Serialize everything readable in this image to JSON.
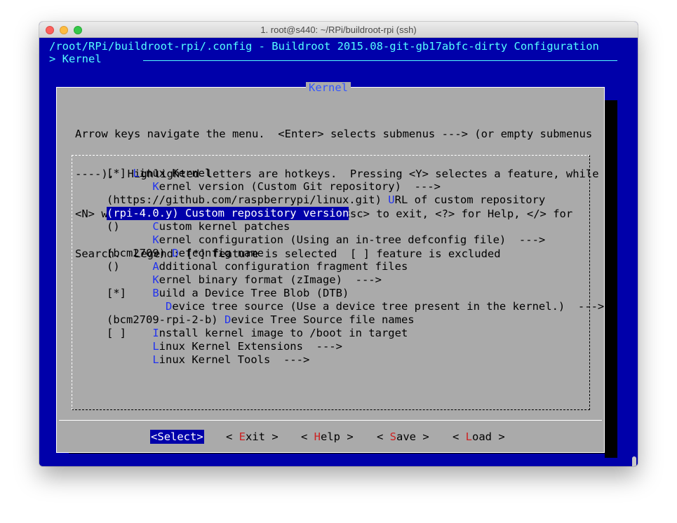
{
  "window": {
    "title": "1. root@s440: ~/RPi/buildroot-rpi (ssh)"
  },
  "header": {
    "path": "/root/RPi/buildroot-rpi/.config - Buildroot 2015.08-git-gb17abfc-dirty Configuration",
    "breadcrumb": "> Kernel"
  },
  "dialog": {
    "title": "Kernel",
    "help_lines": [
      "Arrow keys navigate the menu.  <Enter> selects submenus ---> (or empty submenus",
      "----).  Highlighted letters are hotkeys.  Pressing <Y> selectes a feature, while",
      "<N> will exclude a feature.  Press <Esc><Esc> to exit, <?> for Help, </> for",
      "Search.  Legend: [*] feature is selected  [ ] feature is excluded"
    ]
  },
  "menu": [
    {
      "prefix": "[*] ",
      "hotkey": "L",
      "rest": "inux Kernel"
    },
    {
      "prefix": "       ",
      "hotkey": "K",
      "rest": "ernel version (Custom Git repository)  --->"
    },
    {
      "prefix": "(https://github.com/raspberrypi/linux.git) ",
      "hotkey": "U",
      "rest": "RL of custom repository"
    },
    {
      "prefix": "(rpi-4.0.y) ",
      "hotkey": "C",
      "rest": "ustom repository version",
      "selected": true
    },
    {
      "prefix": "()     ",
      "hotkey": "C",
      "rest": "ustom kernel patches"
    },
    {
      "prefix": "       ",
      "hotkey": "K",
      "rest": "ernel configuration (Using an in-tree defconfig file)  --->"
    },
    {
      "prefix": "(bcm2709) ",
      "hotkey": "D",
      "rest": "efconfig name"
    },
    {
      "prefix": "()     ",
      "hotkey": "A",
      "rest": "dditional configuration fragment files"
    },
    {
      "prefix": "       ",
      "hotkey": "K",
      "rest": "ernel binary format (zImage)  --->"
    },
    {
      "prefix": "[*]    ",
      "hotkey": "B",
      "rest": "uild a Device Tree Blob (DTB)"
    },
    {
      "prefix": "         ",
      "hotkey": "D",
      "rest": "evice tree source (Use a device tree present in the kernel.)  --->"
    },
    {
      "prefix": "(bcm2709-rpi-2-b) ",
      "hotkey": "D",
      "rest": "evice Tree Source file names"
    },
    {
      "prefix": "[ ]    ",
      "hotkey": "I",
      "rest": "nstall kernel image to /boot in target"
    },
    {
      "prefix": "       ",
      "hotkey": "L",
      "rest": "inux Kernel Extensions  --->"
    },
    {
      "prefix": "       ",
      "hotkey": "L",
      "rest": "inux Kernel Tools  --->"
    }
  ],
  "buttons": [
    {
      "left": "<",
      "key": "S",
      "rest": "elect",
      "right": ">",
      "active": true
    },
    {
      "left": "< ",
      "key": "E",
      "rest": "xit",
      "right": " >"
    },
    {
      "left": "< ",
      "key": "H",
      "rest": "elp",
      "right": " >"
    },
    {
      "left": "< ",
      "key": "S",
      "rest": "ave",
      "right": " >"
    },
    {
      "left": "< ",
      "key": "L",
      "rest": "oad",
      "right": " >"
    }
  ]
}
